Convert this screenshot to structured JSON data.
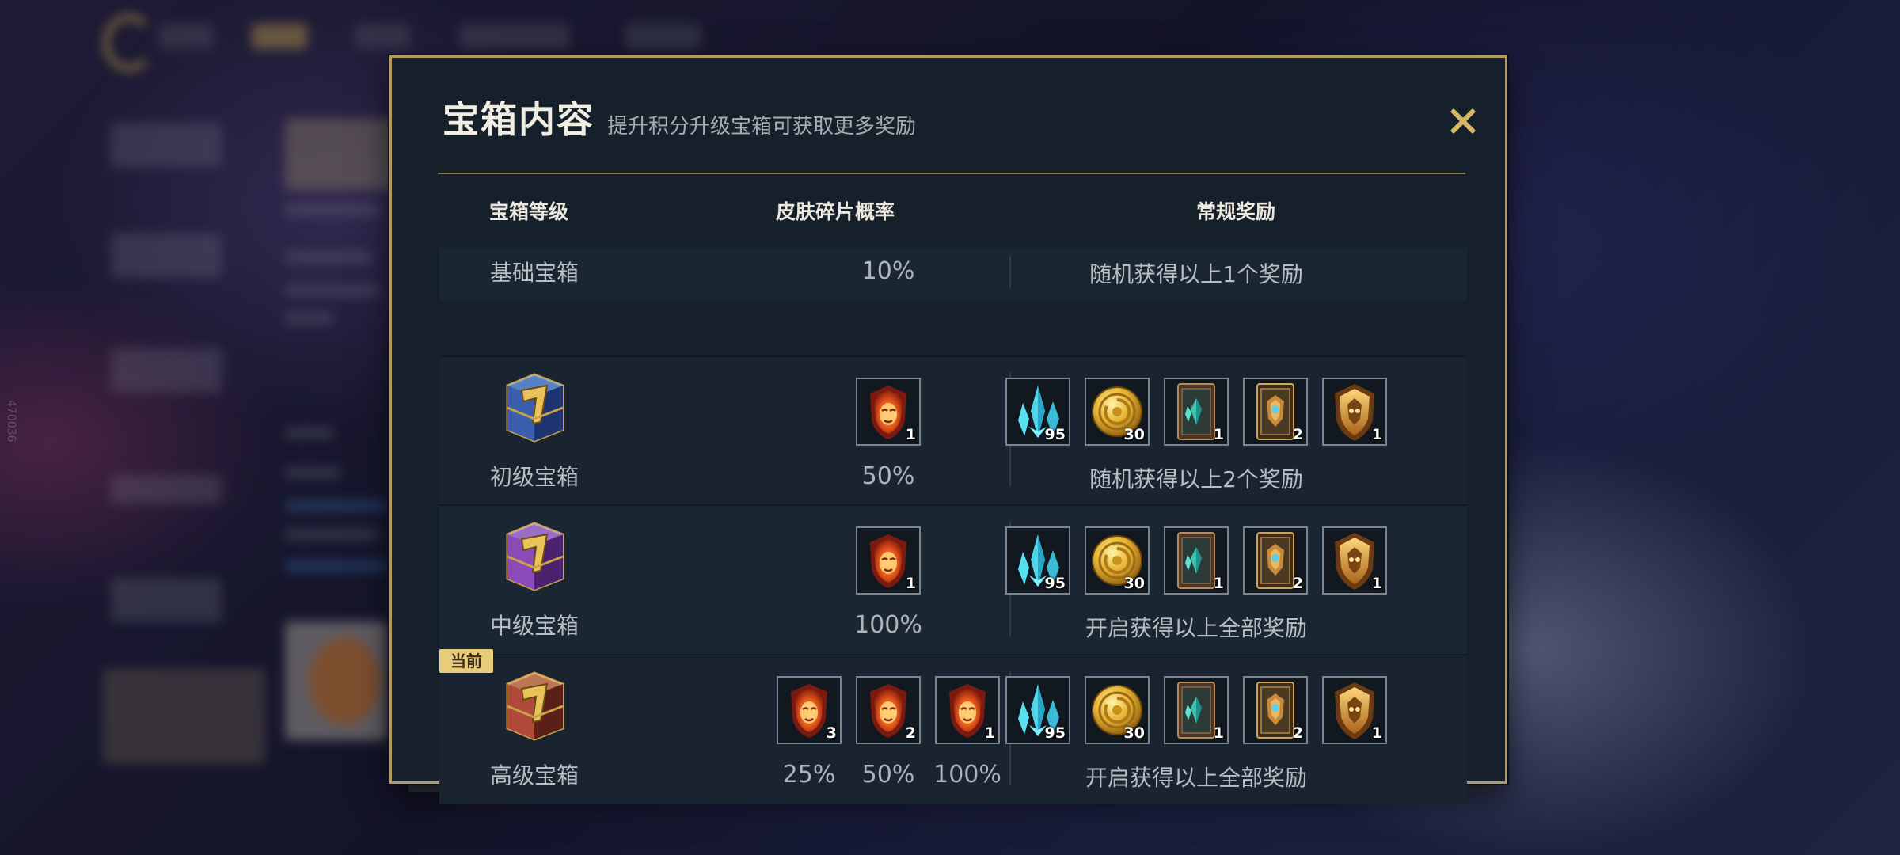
{
  "background": {
    "side_watermark": "470036"
  },
  "modal": {
    "title": "宝箱内容",
    "subtitle": "提升积分升级宝箱可获取更多奖励",
    "close_icon": "close-x",
    "accent_color": "#b49a5e",
    "headers": {
      "tier": "宝箱等级",
      "skin_fragment_rate": "皮肤碎片概率",
      "regular_rewards": "常规奖励"
    },
    "rows": [
      {
        "tier": "基础宝箱",
        "chest_icon": null,
        "fragments": [],
        "rates": [
          "10%"
        ],
        "rewards": [],
        "rewards_text": "随机获得以上1个奖励"
      },
      {
        "tier": "初级宝箱",
        "chest_icon": "blue-chest",
        "fragments": [
          {
            "icon": "skin-fragment-mask",
            "count": "1"
          }
        ],
        "rates": [
          "50%"
        ],
        "rewards": [
          {
            "icon": "blue-crystal",
            "count": "95"
          },
          {
            "icon": "gold-coin",
            "count": "30"
          },
          {
            "icon": "gem-card-green",
            "count": "1"
          },
          {
            "icon": "gem-card-gold",
            "count": "2"
          },
          {
            "icon": "gold-emblem",
            "count": "1"
          }
        ],
        "rewards_text": "随机获得以上2个奖励"
      },
      {
        "tier": "中级宝箱",
        "chest_icon": "purple-chest",
        "fragments": [
          {
            "icon": "skin-fragment-mask",
            "count": "1"
          }
        ],
        "rates": [
          "100%"
        ],
        "rewards": [
          {
            "icon": "blue-crystal",
            "count": "95"
          },
          {
            "icon": "gold-coin",
            "count": "30"
          },
          {
            "icon": "gem-card-green",
            "count": "1"
          },
          {
            "icon": "gem-card-gold",
            "count": "2"
          },
          {
            "icon": "gold-emblem",
            "count": "1"
          }
        ],
        "rewards_text": "开启获得以上全部奖励"
      },
      {
        "tier": "高级宝箱",
        "chest_icon": "red-chest",
        "current_badge": "当前",
        "fragments": [
          {
            "icon": "skin-fragment-mask",
            "count": "3"
          },
          {
            "icon": "skin-fragment-mask",
            "count": "2"
          },
          {
            "icon": "skin-fragment-mask",
            "count": "1"
          }
        ],
        "rates": [
          "25%",
          "50%",
          "100%"
        ],
        "rewards": [
          {
            "icon": "blue-crystal",
            "count": "95"
          },
          {
            "icon": "gold-coin",
            "count": "30"
          },
          {
            "icon": "gem-card-green",
            "count": "1"
          },
          {
            "icon": "gem-card-gold",
            "count": "2"
          },
          {
            "icon": "gold-emblem",
            "count": "1"
          }
        ],
        "rewards_text": "开启获得以上全部奖励"
      }
    ]
  }
}
